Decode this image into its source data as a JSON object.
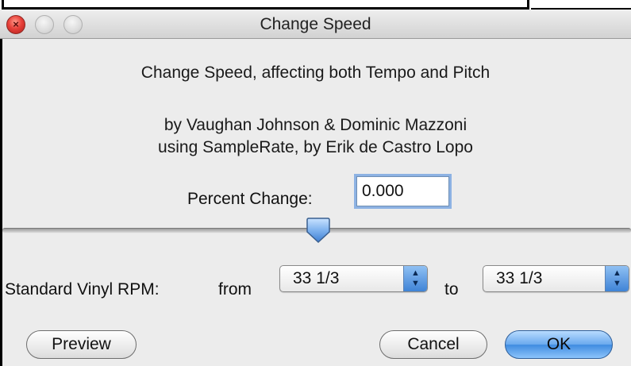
{
  "window": {
    "title": "Change Speed",
    "close_glyph": "×"
  },
  "info": {
    "line1": "Change Speed, affecting both Tempo and Pitch",
    "line2": "by Vaughan Johnson & Dominic Mazzoni",
    "line3": "using SampleRate, by Erik de Castro Lopo"
  },
  "percent_change": {
    "label": "Percent Change:",
    "value": "0.000"
  },
  "slider": {
    "position_fraction": 0.5
  },
  "vinyl": {
    "label": "Standard Vinyl RPM:",
    "from_label": "from",
    "to_label": "to",
    "from_value": "33 1/3",
    "to_value": "33 1/3"
  },
  "buttons": {
    "preview": "Preview",
    "cancel": "Cancel",
    "ok": "OK"
  },
  "icons": {
    "close": "close-icon",
    "minimize": "minimize-icon",
    "maximize": "zoom-icon",
    "select_arrows": "up-down-arrows-icon"
  },
  "colors": {
    "accent": "#5a9be6",
    "close_red": "#e8413a",
    "window_bg": "#ececec"
  }
}
